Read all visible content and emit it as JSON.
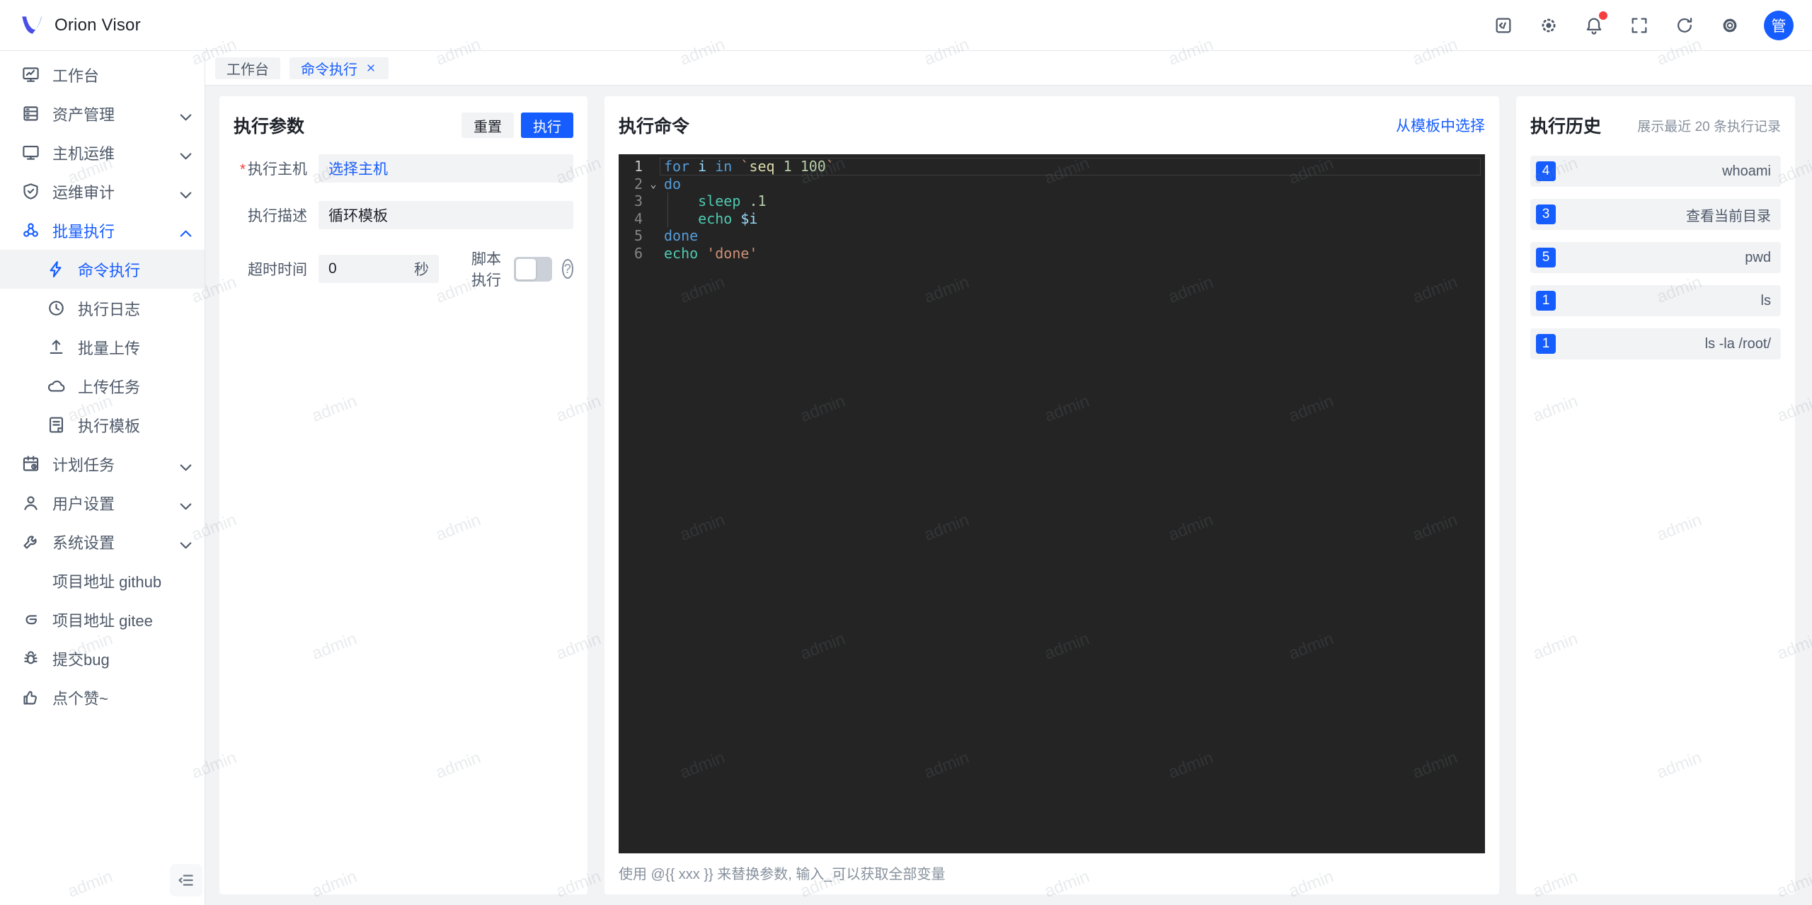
{
  "app": {
    "logo_title": "Orion Visor"
  },
  "topbar": {
    "icons": [
      {
        "name": "api-code"
      },
      {
        "name": "theme-sun"
      },
      {
        "name": "notifications-bell",
        "badge": true
      },
      {
        "name": "fullscreen"
      },
      {
        "name": "refresh"
      },
      {
        "name": "settings-gear"
      }
    ],
    "avatar_text": "管"
  },
  "tabs": [
    {
      "label": "工作台",
      "active": false,
      "closable": false
    },
    {
      "label": "命令执行",
      "active": true,
      "closable": true
    }
  ],
  "sidebar": {
    "items": [
      {
        "label": "工作台",
        "icon": "workbench",
        "type": "top"
      },
      {
        "label": "资产管理",
        "icon": "assets",
        "type": "top",
        "chevron": "down"
      },
      {
        "label": "主机运维",
        "icon": "host-ops",
        "type": "top",
        "chevron": "down"
      },
      {
        "label": "运维审计",
        "icon": "audit",
        "type": "top",
        "chevron": "down"
      },
      {
        "label": "批量执行",
        "icon": "batch",
        "type": "top",
        "chevron": "up",
        "active": true
      },
      {
        "label": "命令执行",
        "icon": "command",
        "type": "sub",
        "selected": true
      },
      {
        "label": "执行日志",
        "icon": "log",
        "type": "sub"
      },
      {
        "label": "批量上传",
        "icon": "upload",
        "type": "sub"
      },
      {
        "label": "上传任务",
        "icon": "cloud",
        "type": "sub"
      },
      {
        "label": "执行模板",
        "icon": "template",
        "type": "sub"
      },
      {
        "label": "计划任务",
        "icon": "schedule",
        "type": "top",
        "chevron": "down"
      },
      {
        "label": "用户设置",
        "icon": "user",
        "type": "top",
        "chevron": "down"
      },
      {
        "label": "系统设置",
        "icon": "system",
        "type": "top",
        "chevron": "down"
      },
      {
        "label": "项目地址 github",
        "icon": "github",
        "type": "top"
      },
      {
        "label": "项目地址 gitee",
        "icon": "gitee",
        "type": "top"
      },
      {
        "label": "提交bug",
        "icon": "bug",
        "type": "top"
      },
      {
        "label": "点个赞~",
        "icon": "like",
        "type": "top"
      }
    ]
  },
  "params_panel": {
    "title": "执行参数",
    "reset_label": "重置",
    "execute_label": "执行",
    "fields": {
      "host_label": "执行主机",
      "host_value": "选择主机",
      "desc_label": "执行描述",
      "desc_value": "循环模板",
      "timeout_label": "超时时间",
      "timeout_value": "0",
      "timeout_unit": "秒",
      "script_label": "脚本执行",
      "script_enabled": false
    }
  },
  "command_panel": {
    "title": "执行命令",
    "template_link": "从模板中选择",
    "hint": "使用 @{{ xxx }} 来替换参数, 输入_可以获取全部变量",
    "code": {
      "lines": [
        {
          "num": "1",
          "current": true,
          "tokens": [
            [
              "kw",
              "for"
            ],
            [
              "pl",
              " "
            ],
            [
              "var",
              "i"
            ],
            [
              "pl",
              " "
            ],
            [
              "kw",
              "in"
            ],
            [
              "pl",
              " "
            ],
            [
              "str",
              "`"
            ],
            [
              "fn",
              "seq"
            ],
            [
              "pl",
              " "
            ],
            [
              "num",
              "1"
            ],
            [
              "pl",
              " "
            ],
            [
              "num",
              "100"
            ],
            [
              "str",
              "`"
            ]
          ]
        },
        {
          "num": "2",
          "fold": true,
          "tokens": [
            [
              "kw",
              "do"
            ]
          ]
        },
        {
          "num": "3",
          "guide": true,
          "tokens": [
            [
              "pl",
              "    "
            ],
            [
              "cmd",
              "sleep"
            ],
            [
              "pl",
              " "
            ],
            [
              "num",
              ".1"
            ]
          ]
        },
        {
          "num": "4",
          "guide": true,
          "tokens": [
            [
              "pl",
              "    "
            ],
            [
              "cmd",
              "echo"
            ],
            [
              "pl",
              " "
            ],
            [
              "var",
              "$i"
            ]
          ]
        },
        {
          "num": "5",
          "tokens": [
            [
              "kw",
              "done"
            ]
          ]
        },
        {
          "num": "6",
          "tokens": [
            [
              "cmd",
              "echo"
            ],
            [
              "pl",
              " "
            ],
            [
              "str",
              "'done'"
            ]
          ]
        }
      ]
    }
  },
  "history_panel": {
    "title": "执行历史",
    "subtitle": "展示最近 20 条执行记录",
    "items": [
      {
        "count": "4",
        "label": "whoami"
      },
      {
        "count": "3",
        "label": "查看当前目录"
      },
      {
        "count": "5",
        "label": "pwd"
      },
      {
        "count": "1",
        "label": "ls"
      },
      {
        "count": "1",
        "label": "ls -la /root/"
      }
    ]
  },
  "watermark": {
    "text": "admin"
  },
  "colors": {
    "accent": "#165dff",
    "badge_red": "#f53f3f",
    "editor_bg": "#242424"
  }
}
